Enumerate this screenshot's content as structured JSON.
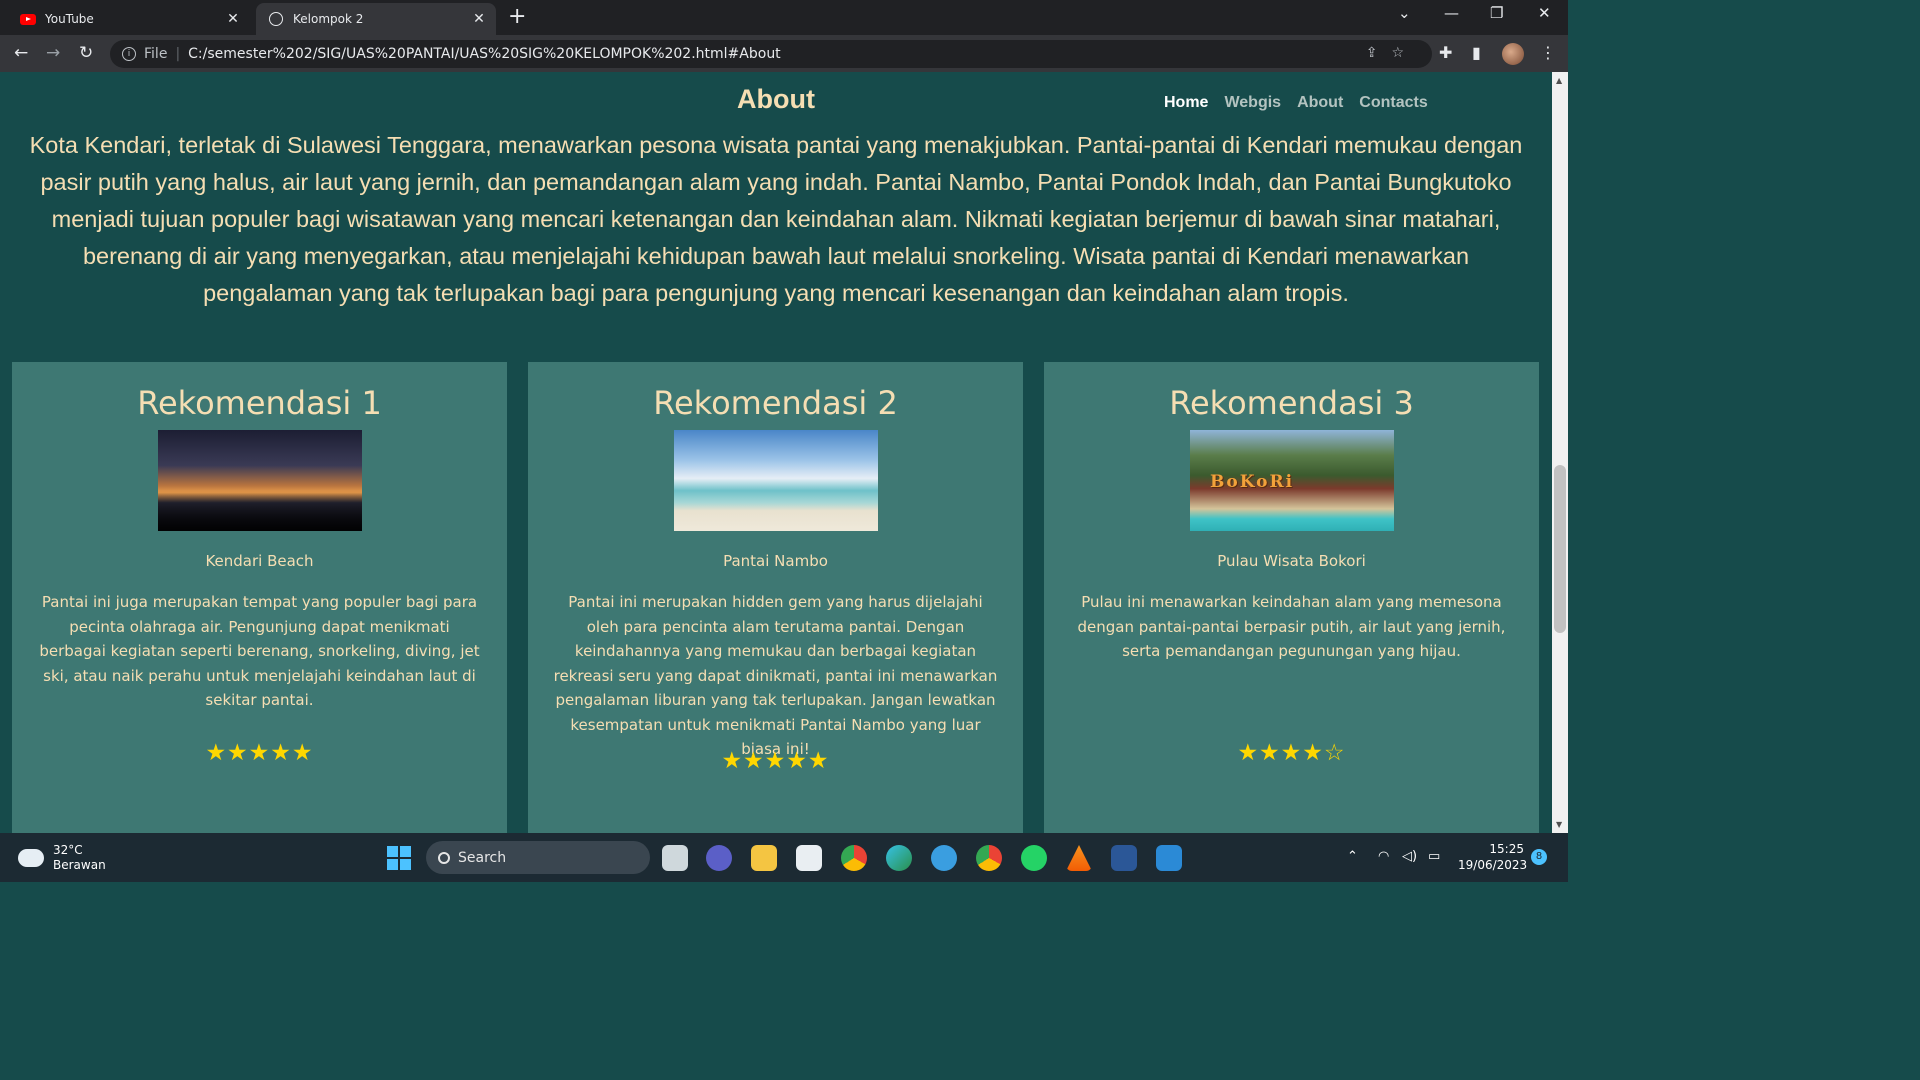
{
  "browser": {
    "tabs": [
      {
        "title": "YouTube",
        "icon": "youtube-icon"
      },
      {
        "title": "Kelompok 2",
        "icon": "globe-icon"
      }
    ],
    "address": {
      "scheme_label": "File",
      "url": "C:/semester%202/SIG/UAS%20PANTAI/UAS%20SIG%20KELOMPOK%202.html#About"
    }
  },
  "page": {
    "about_title": "About",
    "nav": [
      "Home",
      "Webgis",
      "About",
      "Contacts"
    ],
    "about_text": "Kota Kendari, terletak di Sulawesi Tenggara, menawarkan pesona wisata pantai yang menakjubkan. Pantai-pantai di Kendari memukau dengan pasir putih yang halus, air laut yang jernih, dan pemandangan alam yang indah. Pantai Nambo, Pantai Pondok Indah, dan Pantai Bungkutoko menjadi tujuan populer bagi wisatawan yang mencari ketenangan dan keindahan alam. Nikmati kegiatan berjemur di bawah sinar matahari, berenang di air yang menyegarkan, atau menjelajahi kehidupan bawah laut melalui snorkeling. Wisata pantai di Kendari menawarkan pengalaman yang tak terlupakan bagi para pengunjung yang mencari kesenangan dan keindahan alam tropis.",
    "cards": [
      {
        "title": "Rekomendasi 1",
        "name": "Kendari Beach",
        "desc": "Pantai ini juga merupakan tempat yang populer bagi para pecinta olahraga air. Pengunjung dapat menikmati berbagai kegiatan seperti berenang, snorkeling, diving, jet ski, atau naik perahu untuk menjelajahi keindahan laut di sekitar pantai.",
        "rating": 5,
        "stars": "★★★★★"
      },
      {
        "title": "Rekomendasi 2",
        "name": "Pantai Nambo",
        "desc": "Pantai ini merupakan hidden gem yang harus dijelajahi oleh para pencinta alam terutama pantai. Dengan keindahannya yang memukau dan berbagai kegiatan rekreasi seru yang dapat dinikmati, pantai ini menawarkan pengalaman liburan yang tak terlupakan. Jangan lewatkan kesempatan untuk menikmati Pantai Nambo yang luar biasa ini!",
        "rating": 5,
        "stars": "★★★★★"
      },
      {
        "title": "Rekomendasi 3",
        "name": "Pulau Wisata Bokori",
        "desc": "Pulau ini menawarkan keindahan alam yang memesona dengan pantai-pantai berpasir putih, air laut yang jernih, serta pemandangan pegunungan yang hijau.",
        "rating": 4,
        "stars": "★★★★☆",
        "photo_text": "BoKoRi"
      }
    ]
  },
  "taskbar": {
    "weather_temp": "32°C",
    "weather_desc": "Berawan",
    "search_label": "Search",
    "time": "15:25",
    "date": "19/06/2023",
    "notifications": "8"
  }
}
